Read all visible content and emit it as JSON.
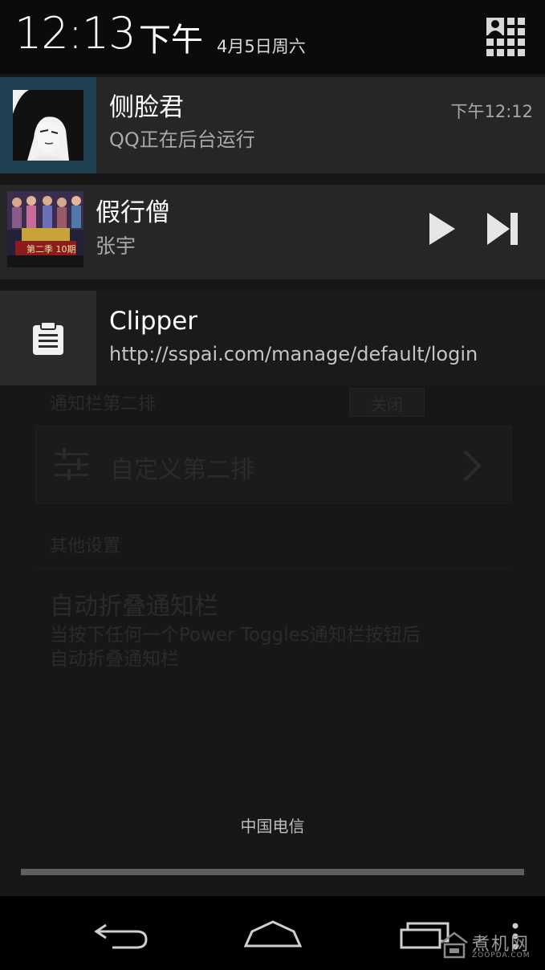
{
  "status_header": {
    "time": "12:13",
    "ampm": "下午",
    "date": "4月5日周六"
  },
  "notifications": [
    {
      "app": "QQ",
      "title": "侧脸君",
      "text": "QQ正在后台运行",
      "time": "下午12:12"
    },
    {
      "app": "music-player",
      "title": "假行僧",
      "text": "张宇",
      "album_label": "第二季 10期"
    },
    {
      "app": "clipper",
      "title": "Clipper",
      "text": "http://sspai.com/manage/default/login"
    }
  ],
  "background_settings": {
    "section_header": "通知栏第二排",
    "toggle_label": "关闭",
    "customize_label": "自定义第二排",
    "other_section": "其他设置",
    "option_title": "自动折叠通知栏",
    "option_desc": "当按下任何一个Power Toggles通知栏按钮后自动折叠通知栏"
  },
  "carrier": "中国电信",
  "watermark": {
    "cn": "煮机网",
    "en": "ZOOPDA.COM"
  },
  "colors": {
    "header_bg": "#0b0b0b",
    "notification_bg": "#262626",
    "qq_thumb_accent": "#1f4050",
    "navbar_bg": "#000000"
  }
}
